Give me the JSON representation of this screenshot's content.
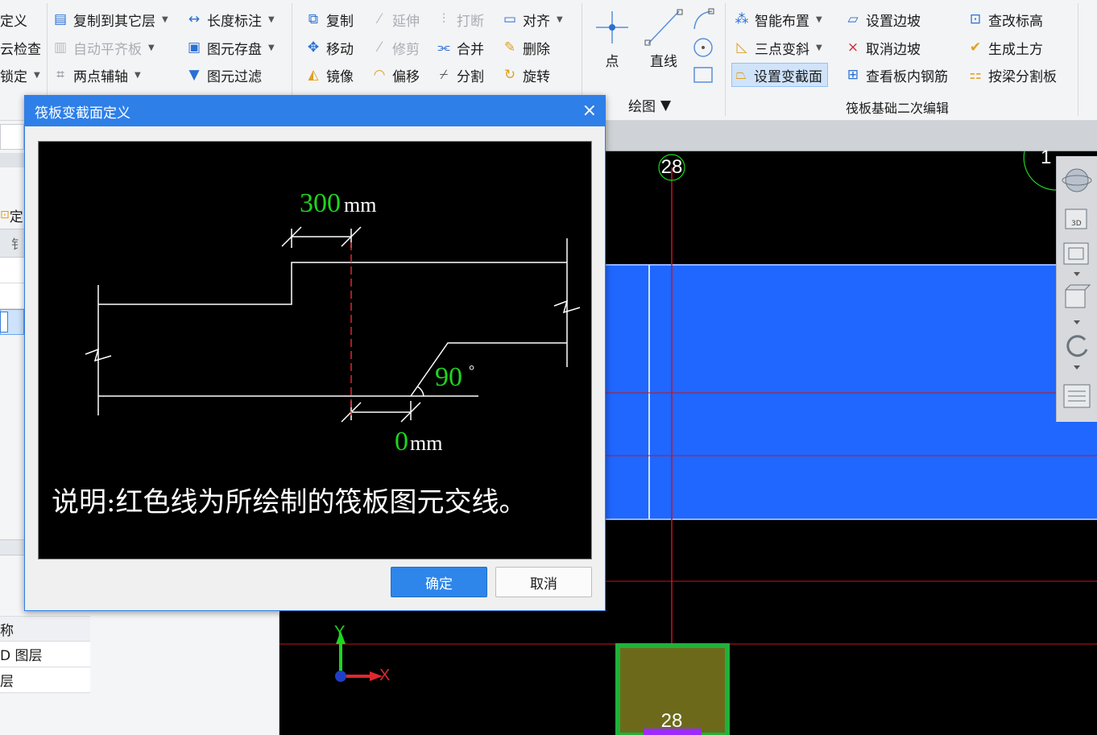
{
  "ribbon": {
    "col1": [
      {
        "label": "定义"
      },
      {
        "label": "云检查"
      },
      {
        "label": "锁定"
      }
    ],
    "col2": [
      {
        "label": "复制到其它层"
      },
      {
        "label": "自动平齐板"
      },
      {
        "label": "两点辅轴"
      }
    ],
    "col3": [
      {
        "label": "长度标注"
      },
      {
        "label": "图元存盘"
      },
      {
        "label": "图元过滤"
      }
    ],
    "col4": [
      {
        "label": "复制"
      },
      {
        "label": "移动"
      },
      {
        "label": "镜像"
      }
    ],
    "col5": [
      {
        "label": "延伸"
      },
      {
        "label": "修剪"
      },
      {
        "label": "偏移"
      }
    ],
    "col6": [
      {
        "label": "打断"
      },
      {
        "label": "合并"
      },
      {
        "label": "分割"
      }
    ],
    "col7": [
      {
        "label": "对齐"
      },
      {
        "label": "删除"
      },
      {
        "label": "旋转"
      }
    ],
    "draw": {
      "point_label": "点",
      "line_label": "直线",
      "group_label": "绘图"
    },
    "col8": [
      {
        "label": "智能布置"
      },
      {
        "label": "三点变斜"
      },
      {
        "label": "设置变截面"
      }
    ],
    "col9": [
      {
        "label": "设置边坡"
      },
      {
        "label": "取消边坡"
      },
      {
        "label": "查看板内钢筋"
      }
    ],
    "col10": [
      {
        "label": "查改标高"
      },
      {
        "label": "生成土方"
      },
      {
        "label": "按梁分割板"
      }
    ],
    "group2_label": "筏板基础二次编辑"
  },
  "left_panel": {
    "snippets": [
      {
        "label": "定"
      },
      {
        "label": "钅"
      }
    ],
    "table": {
      "header": "称",
      "rows": [
        "D 图层",
        "层"
      ]
    }
  },
  "canvas": {
    "axis_label_top": "28",
    "axis_label_bottom": "28",
    "corner_label": "1",
    "ucs": {
      "x": "X",
      "y": "Y"
    }
  },
  "dialog": {
    "title": "筏板变截面定义",
    "close_glyph": "×",
    "offset_value": "300",
    "offset_unit": "mm",
    "angle_value": "90",
    "angle_unit": "°",
    "width_value": "0",
    "width_unit": "mm",
    "note": "说明:红色线为所绘制的筏板图元交线。",
    "ok_label": "确定",
    "cancel_label": "取消"
  },
  "colors": {
    "slab_blue": "#1f67ff",
    "axis_red": "#c8141e",
    "dim_green": "#1dd61d",
    "dialog_title": "#2e7fe8"
  }
}
